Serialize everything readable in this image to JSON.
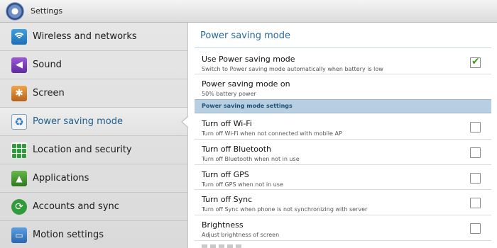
{
  "app": {
    "title": "Settings"
  },
  "sidebar": {
    "items": [
      {
        "label": "Wireless and networks",
        "icon": "wifi-icon"
      },
      {
        "label": "Sound",
        "icon": "speaker-icon"
      },
      {
        "label": "Screen",
        "icon": "display-icon"
      },
      {
        "label": "Power saving mode",
        "icon": "battery-recycle-icon",
        "selected": true
      },
      {
        "label": "Location and security",
        "icon": "location-grid-icon"
      },
      {
        "label": "Applications",
        "icon": "applications-icon"
      },
      {
        "label": "Accounts and sync",
        "icon": "sync-icon"
      },
      {
        "label": "Motion settings",
        "icon": "motion-icon"
      }
    ]
  },
  "panel": {
    "title": "Power saving mode",
    "use_power_saving": {
      "title": "Use Power saving mode",
      "subtitle": "Switch to Power saving mode automatically when battery is low",
      "checked": true
    },
    "power_saving_on": {
      "title": "Power saving mode on",
      "subtitle": "50% battery power"
    },
    "section_header": "Power saving mode settings",
    "settings": [
      {
        "title": "Turn off Wi-Fi",
        "subtitle": "Turn off Wi-Fi when not connected with mobile AP",
        "checked": false
      },
      {
        "title": "Turn off Bluetooth",
        "subtitle": "Turn off Bluetooth when not in use",
        "checked": false
      },
      {
        "title": "Turn off GPS",
        "subtitle": "Turn off GPS when not in use",
        "checked": false
      },
      {
        "title": "Turn off Sync",
        "subtitle": "Turn off Sync when phone is not synchronizing with server",
        "checked": false
      },
      {
        "title": "Brightness",
        "subtitle": "Adjust brightness of screen",
        "checked": false
      }
    ]
  },
  "colors": {
    "accent": "#2a6aa0",
    "section": "#b7cfe0",
    "check": "#3e9a1c"
  }
}
